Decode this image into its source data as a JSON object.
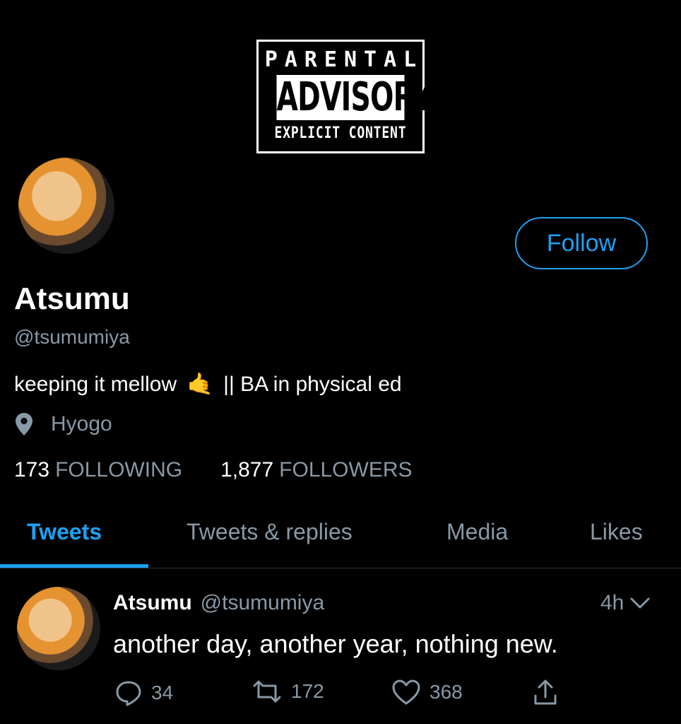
{
  "banner": {
    "line1": "PARENTAL",
    "line2": "ADVISORY",
    "line3": "EXPLICIT CONTENT"
  },
  "profile": {
    "follow_label": "Follow",
    "name": "Atsumu",
    "handle": "@tsumumiya",
    "bio_before": "keeping it mellow",
    "bio_emoji": "🤙",
    "bio_after": "|| BA in physical ed",
    "location": "Hyogo",
    "following_count": "173",
    "following_label": "FOLLOWING",
    "followers_count": "1,877",
    "followers_label": "FOLLOWERS"
  },
  "tabs": [
    {
      "label": "Tweets",
      "active": true
    },
    {
      "label": "Tweets & replies",
      "active": false
    },
    {
      "label": "Media",
      "active": false
    },
    {
      "label": "Likes",
      "active": false
    }
  ],
  "tweet": {
    "author_name": "Atsumu",
    "author_handle": "@tsumumiya",
    "time": "4h",
    "text": "another day, another year, nothing new.",
    "replies": "34",
    "retweets": "172",
    "likes": "368"
  },
  "colors": {
    "accent": "#1da1f2",
    "muted": "#8899a6",
    "background": "#000000"
  }
}
